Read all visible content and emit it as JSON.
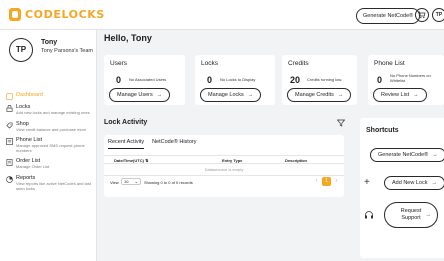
{
  "app": {
    "logo_text": "CODELOCKS",
    "brand_color": "#f5a623"
  },
  "header": {
    "generate_button": "Generate NetCode®",
    "avatar_initials": "TP"
  },
  "profile": {
    "initials": "TP",
    "name": "Tony",
    "team": "Tony Parsons's Team"
  },
  "nav": [
    {
      "label": "Dashboard",
      "desc": "",
      "icon": "dashboard-icon",
      "active": true
    },
    {
      "label": "Locks",
      "desc": "Add new locks and manage existing ones",
      "icon": "lock-icon"
    },
    {
      "label": "Shop",
      "desc": "View credit balance and purchase more",
      "icon": "shop-icon"
    },
    {
      "label": "Phone List",
      "desc": "Manage approved SMS request phone numbers",
      "icon": "phone-list-icon"
    },
    {
      "label": "Order List",
      "desc": "Manage Order List",
      "icon": "order-list-icon"
    },
    {
      "label": "Reports",
      "desc": "View reports like active NetCodes and last seen locks",
      "icon": "reports-icon"
    }
  ],
  "greeting": "Hello, Tony",
  "cards": {
    "users": {
      "title": "Users",
      "count": "0",
      "text": "No Associated Users",
      "button": "Manage Users"
    },
    "locks": {
      "title": "Locks",
      "count": "0",
      "text": "No Locks to Display",
      "button": "Manage Locks"
    },
    "credits": {
      "title": "Credits",
      "count": "20",
      "text": "Credits running low.",
      "button": "Manage Credits"
    },
    "phone": {
      "title": "Phone List",
      "count": "0",
      "text_line1": "No Phone Numbers on",
      "text_line2": "Whitelist",
      "button": "Review List"
    }
  },
  "lock_activity": {
    "title": "Lock Activity",
    "tabs": [
      "Recent Activity",
      "NetCode® History"
    ],
    "columns": [
      "Date/Time(UTC)",
      "Entry Type",
      "Description"
    ],
    "empty_text": "Dataseource is empty",
    "view_label": "View",
    "page_size": "10",
    "showing": "Showing 0 to 0 of 0 records",
    "current_page": "1"
  },
  "shortcuts": {
    "title": "Shortcuts",
    "generate": "Generate NetCode®",
    "add_lock": "Add New Lock",
    "request_support_line1": "Request",
    "request_support_line2": "Support"
  }
}
